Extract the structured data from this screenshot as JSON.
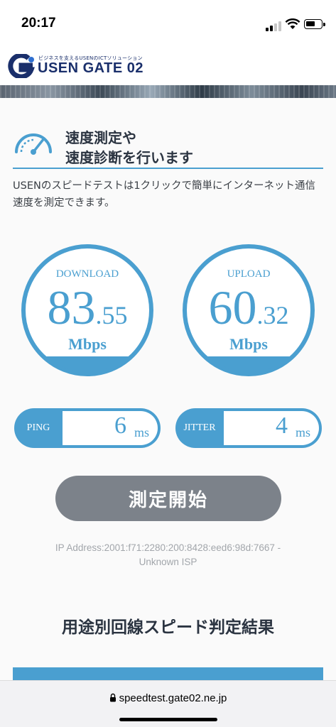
{
  "status_bar": {
    "time": "20:17"
  },
  "header": {
    "tagline": "ビジネスを支えるUSENのICTソリューション",
    "logo_text": "USEN GATE 02"
  },
  "intro": {
    "heading_line1": "速度測定や",
    "heading_line2": "速度診断を行います",
    "description": "USENのスピードテストは1クリックで簡単にインターネット通信速度を測定できます。"
  },
  "download": {
    "label": "DOWNLOAD",
    "value_int": "83",
    "value_dec": ".55",
    "unit": "Mbps"
  },
  "upload": {
    "label": "UPLOAD",
    "value_int": "60",
    "value_dec": ".32",
    "unit": "Mbps"
  },
  "ping": {
    "label": "PING",
    "value": "6",
    "unit": "ms"
  },
  "jitter": {
    "label": "JITTER",
    "value": "4",
    "unit": "ms"
  },
  "start_button": {
    "label": "測定開始"
  },
  "ip_info": {
    "line1": "IP Address:2001:f71:2280:200:8428:eed6:98d:7667 -",
    "line2": "Unknown ISP"
  },
  "section": {
    "title": "用途別回線スピード判定結果"
  },
  "browser": {
    "url": "speedtest.gate02.ne.jp"
  },
  "colors": {
    "accent": "#4a9fd0",
    "button": "#7c828a",
    "brand": "#1a2f6b"
  }
}
